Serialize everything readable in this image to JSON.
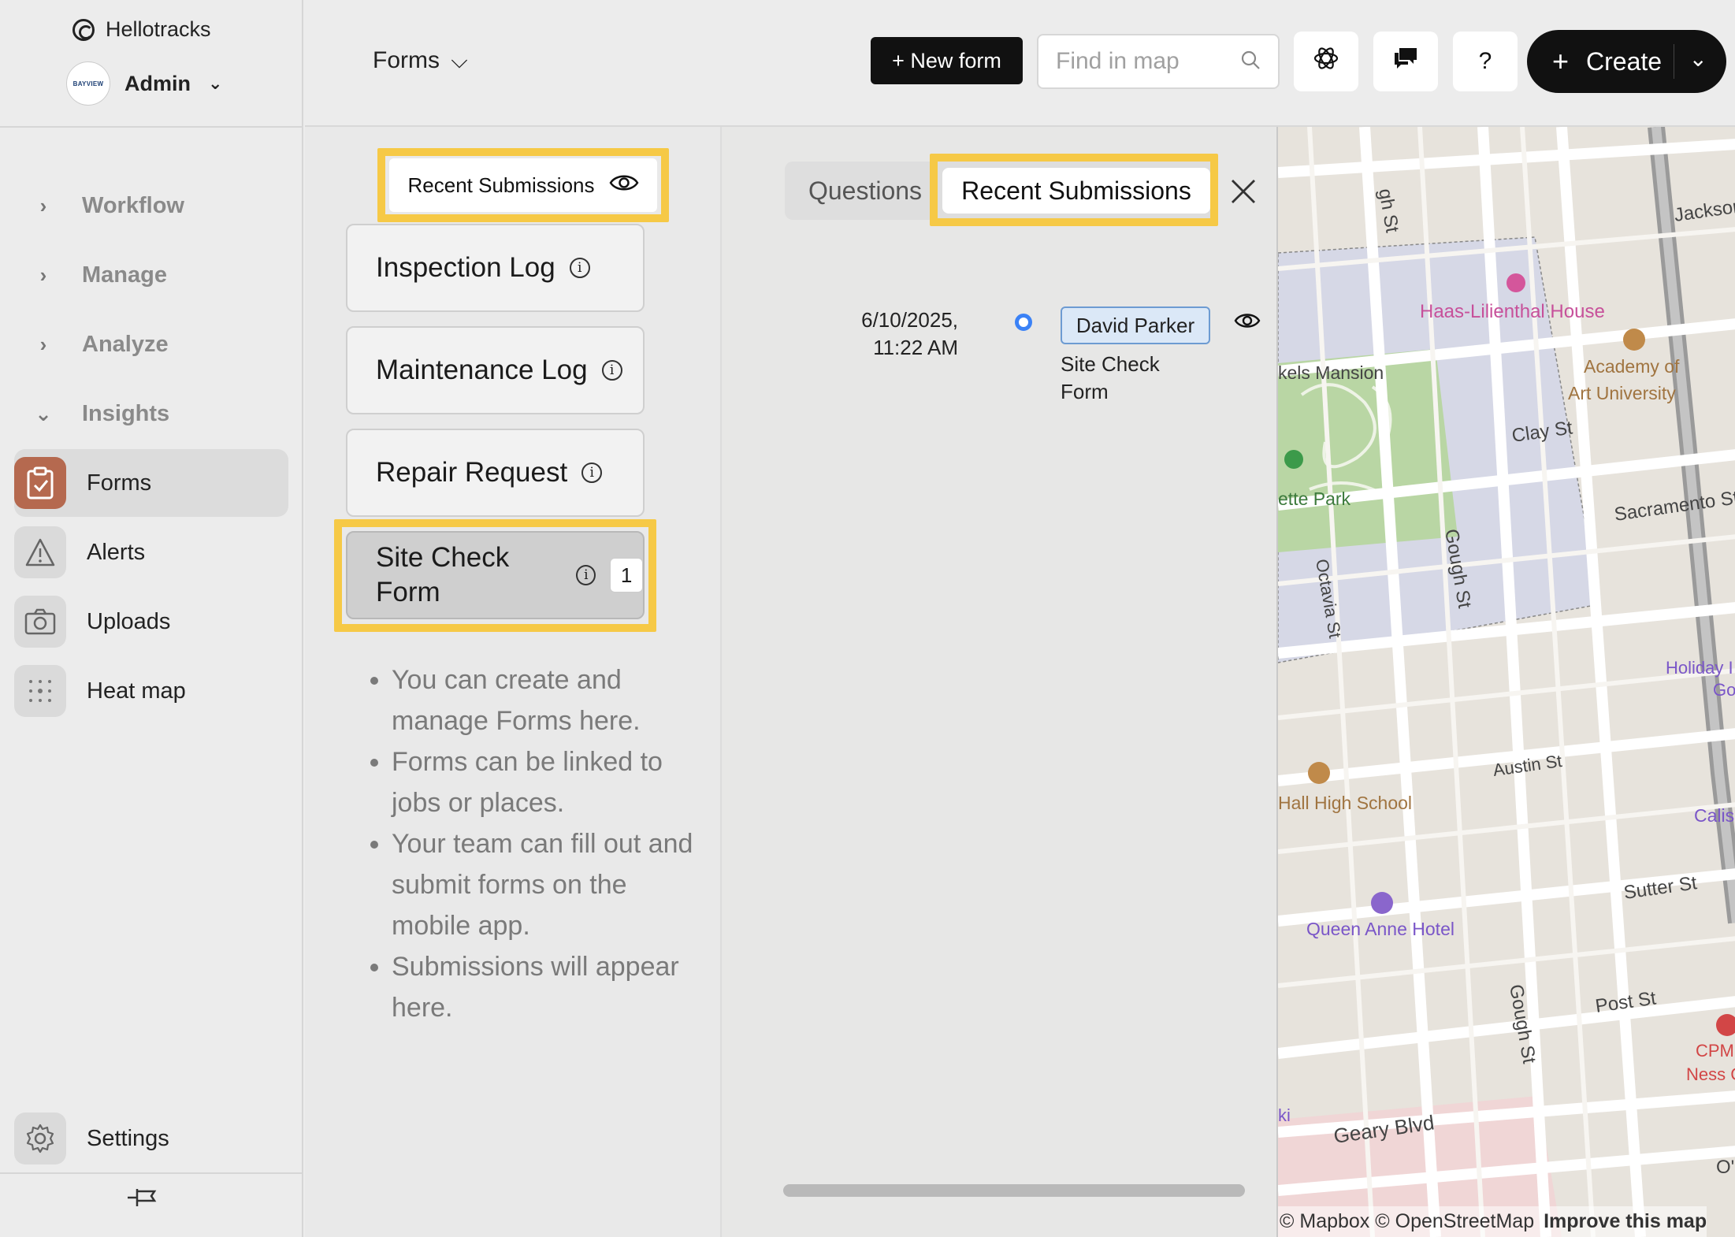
{
  "brand": {
    "name": "Hellotracks"
  },
  "account": {
    "name": "Admin",
    "logo_text": "BAYVIEW"
  },
  "sidebar": {
    "groups": [
      {
        "label": "Workflow",
        "state": "collapsed"
      },
      {
        "label": "Manage",
        "state": "collapsed"
      },
      {
        "label": "Analyze",
        "state": "collapsed"
      },
      {
        "label": "Insights",
        "state": "expanded"
      }
    ],
    "items": [
      {
        "label": "Forms",
        "icon": "clipboard-icon",
        "active": true
      },
      {
        "label": "Alerts",
        "icon": "warning-icon",
        "active": false
      },
      {
        "label": "Uploads",
        "icon": "camera-icon",
        "active": false
      },
      {
        "label": "Heat map",
        "icon": "dots-grid-icon",
        "active": false
      }
    ],
    "settings_label": "Settings"
  },
  "topbar": {
    "section_label": "Forms",
    "new_form_label": "+ New form",
    "search_placeholder": "Find in map",
    "help_label": "?",
    "create_label": "Create"
  },
  "forms_panel": {
    "recent_toggle_label": "Recent Submissions",
    "forms": [
      {
        "title": "Inspection Log",
        "count": null
      },
      {
        "title": "Maintenance Log",
        "count": null
      },
      {
        "title": "Repair Request",
        "count": null
      },
      {
        "title": "Site Check Form",
        "count": "1",
        "selected": true
      }
    ],
    "help": [
      "You can create and manage Forms here.",
      "Forms can be linked to jobs or places.",
      "Your team can fill out and submit forms on the mobile app.",
      "Submissions will appear here."
    ]
  },
  "detail_panel": {
    "tabs": [
      {
        "label": "Questions",
        "active": false
      },
      {
        "label": "Recent Submissions",
        "active": true
      }
    ],
    "submission": {
      "date_line1": "6/10/2025,",
      "date_line2": "11:22 AM",
      "user": "David Parker",
      "form": "Site Check Form"
    }
  },
  "map": {
    "labels": {
      "jackson": "Jackson S",
      "gough_top": "gh St",
      "haas": "Haas-Lilienthal House",
      "academy1": "Academy of",
      "academy2": "Art University",
      "mansion": "kels Mansion",
      "clay": "Clay St",
      "park": "ette Park",
      "sacramento": "Sacramento St",
      "gough_mid": "Gough St",
      "octavia": "Octavia St",
      "holiday1": "Holiday I",
      "holiday2": "Gol",
      "austin": "Austin St",
      "hall": "Hall High School",
      "calis": "Calis",
      "sutter": "Sutter St",
      "queen": "Queen Anne Hotel",
      "gough_low": "Gough St",
      "post": "Post St",
      "cpmc1": "CPMC",
      "cpmc2": "Ness Ca",
      "geary": "Geary Blvd",
      "ki": "ki",
      "o": "O'"
    },
    "attribution": "© Mapbox © OpenStreetMap",
    "improve_link": "Improve this map"
  },
  "colors": {
    "highlight": "#f6c946",
    "accent": "#b5694f",
    "dot": "#3b82f6"
  }
}
